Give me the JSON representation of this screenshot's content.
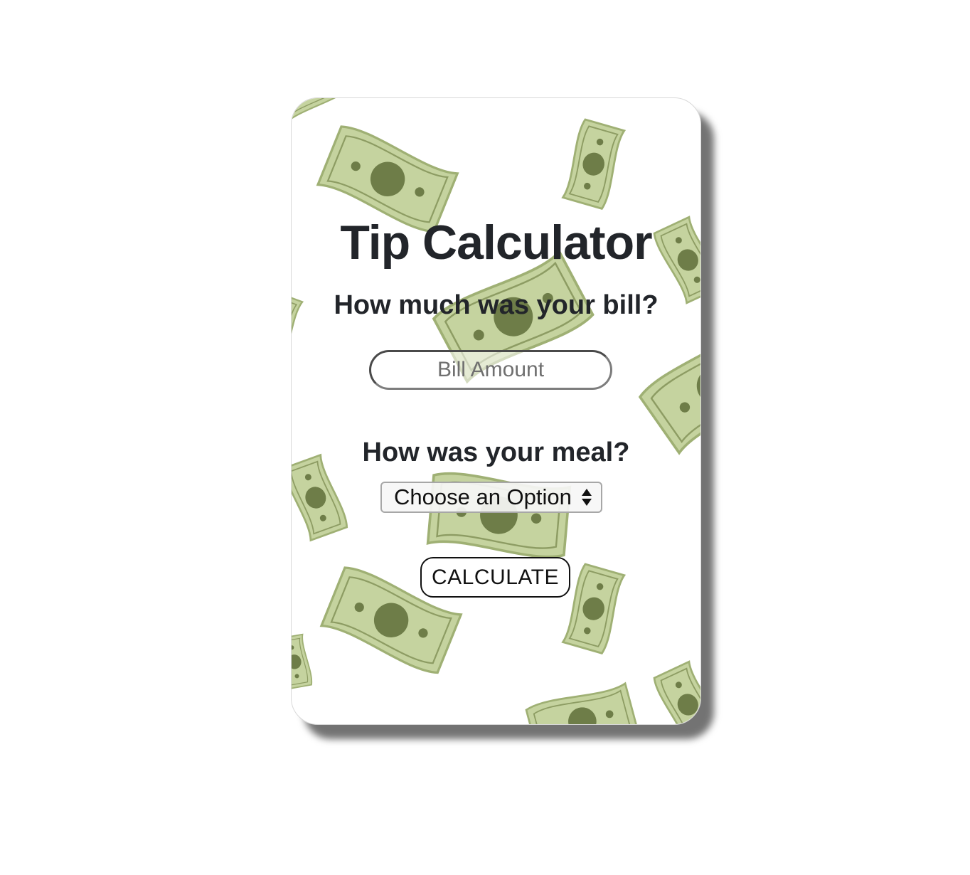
{
  "app": {
    "title": "Tip Calculator"
  },
  "form": {
    "bill_question": "How much was your bill?",
    "bill_input": {
      "placeholder": "Bill Amount",
      "value": ""
    },
    "meal_question": "How was your meal?",
    "meal_select": {
      "selected_label": "Choose an Option"
    },
    "calculate_label": "CALCULATE"
  },
  "theme": {
    "text_color": "#22252a",
    "bill_light_green": "#c5d39f",
    "bill_dark_green": "#6e7d48",
    "card_background": "#ffffff"
  },
  "icons": {
    "select_arrows": "up-down-chevron-icon",
    "background_pattern": "dollar-bill-icon"
  }
}
